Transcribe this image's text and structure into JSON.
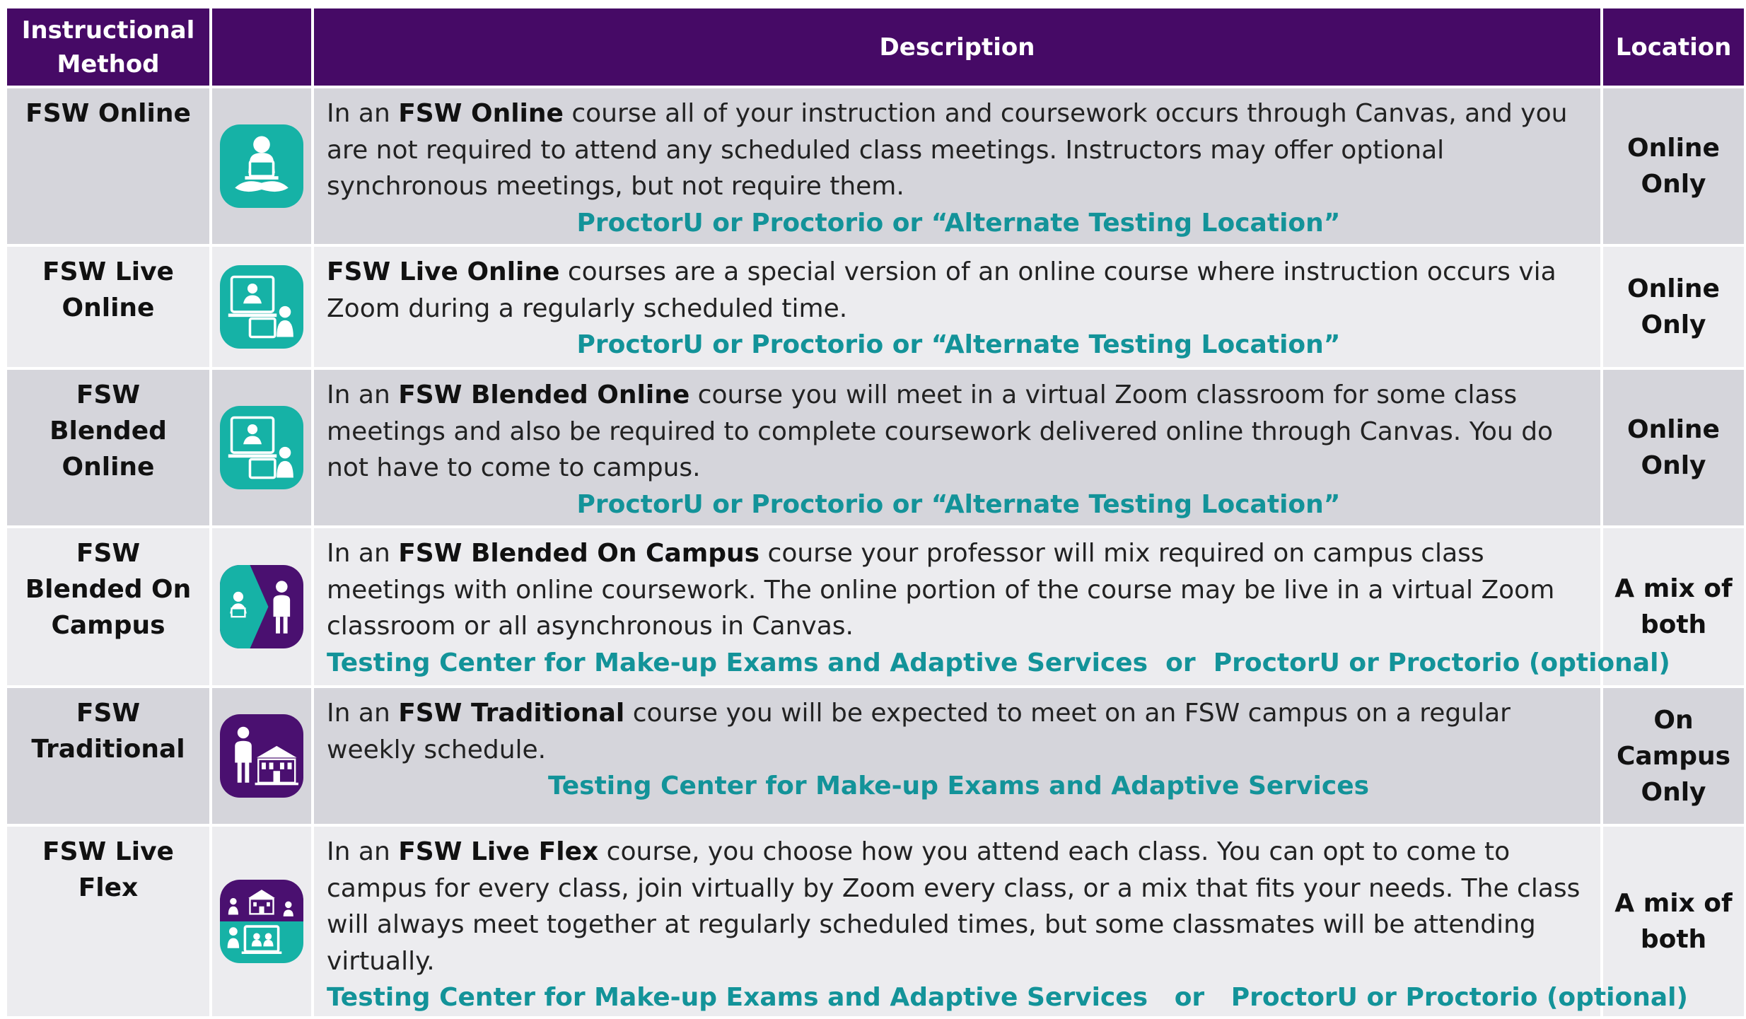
{
  "header": {
    "method": "Instructional Method",
    "description": "Description",
    "location": "Location"
  },
  "colors": {
    "header_bg": "#460a66",
    "teal": "#16b2a6",
    "purple": "#4a1070",
    "testing_text": "#139399"
  },
  "rows": [
    {
      "method": "FSW Online",
      "icon": "person-laptop-icon",
      "desc_pre": "In an ",
      "desc_bold": "FSW Online",
      "desc_post": " course all of your instruction and coursework occurs through Canvas, and you are not required to attend any scheduled class meetings. Instructors may offer optional synchronous meetings, but not require them.",
      "testing": "ProctorU or Proctorio or “Alternate Testing Location”",
      "location": "Online Only"
    },
    {
      "method": "FSW Live Online",
      "icon": "zoom-lecture-icon",
      "desc_pre": "",
      "desc_bold": "FSW Live Online",
      "desc_post": " courses are a special version of an online course where instruction occurs via Zoom during a regularly scheduled time.",
      "testing": "ProctorU or Proctorio or “Alternate Testing Location”",
      "location": "Online Only"
    },
    {
      "method": "FSW Blended Online",
      "icon": "zoom-lecture-icon",
      "desc_pre": "In an ",
      "desc_bold": "FSW Blended Online",
      "desc_post": " course you will meet in a virtual Zoom classroom for some class meetings and also be required to complete coursework delivered online through Canvas. You do not have to come to campus.",
      "testing": "ProctorU or Proctorio or “Alternate Testing Location”",
      "location": "Online Only"
    },
    {
      "method": "FSW Blended On Campus",
      "icon": "blended-campus-icon",
      "desc_pre": "In an ",
      "desc_bold": "FSW Blended On Campus",
      "desc_post": " course your professor will mix required on campus class meetings with online coursework. The online portion of the course may be live in a virtual Zoom classroom or all asynchronous in Canvas.",
      "testing": "Testing Center for Make-up Exams and Adaptive Services  or  ProctorU or Proctorio (optional)",
      "location": "A mix of both"
    },
    {
      "method": "FSW Traditional",
      "icon": "campus-building-icon",
      "desc_pre": "In an ",
      "desc_bold": "FSW Traditional",
      "desc_post": " course you will be expected to meet on an FSW campus on a regular weekly schedule.",
      "testing": "Testing Center for Make-up Exams and Adaptive Services",
      "location": "On Campus Only"
    },
    {
      "method": "FSW Live Flex",
      "icon": "live-flex-icon",
      "desc_pre": "In an ",
      "desc_bold": "FSW Live Flex",
      "desc_post": " course, you choose how you attend each class. You can opt to come to campus for every class, join virtually by Zoom every class, or a mix that fits your needs. The class will always meet together at regularly scheduled times, but some classmates will be attending virtually.",
      "testing": "Testing Center for Make-up Exams and Adaptive Services   or   ProctorU or Proctorio (optional)",
      "location": "A mix of both"
    }
  ]
}
